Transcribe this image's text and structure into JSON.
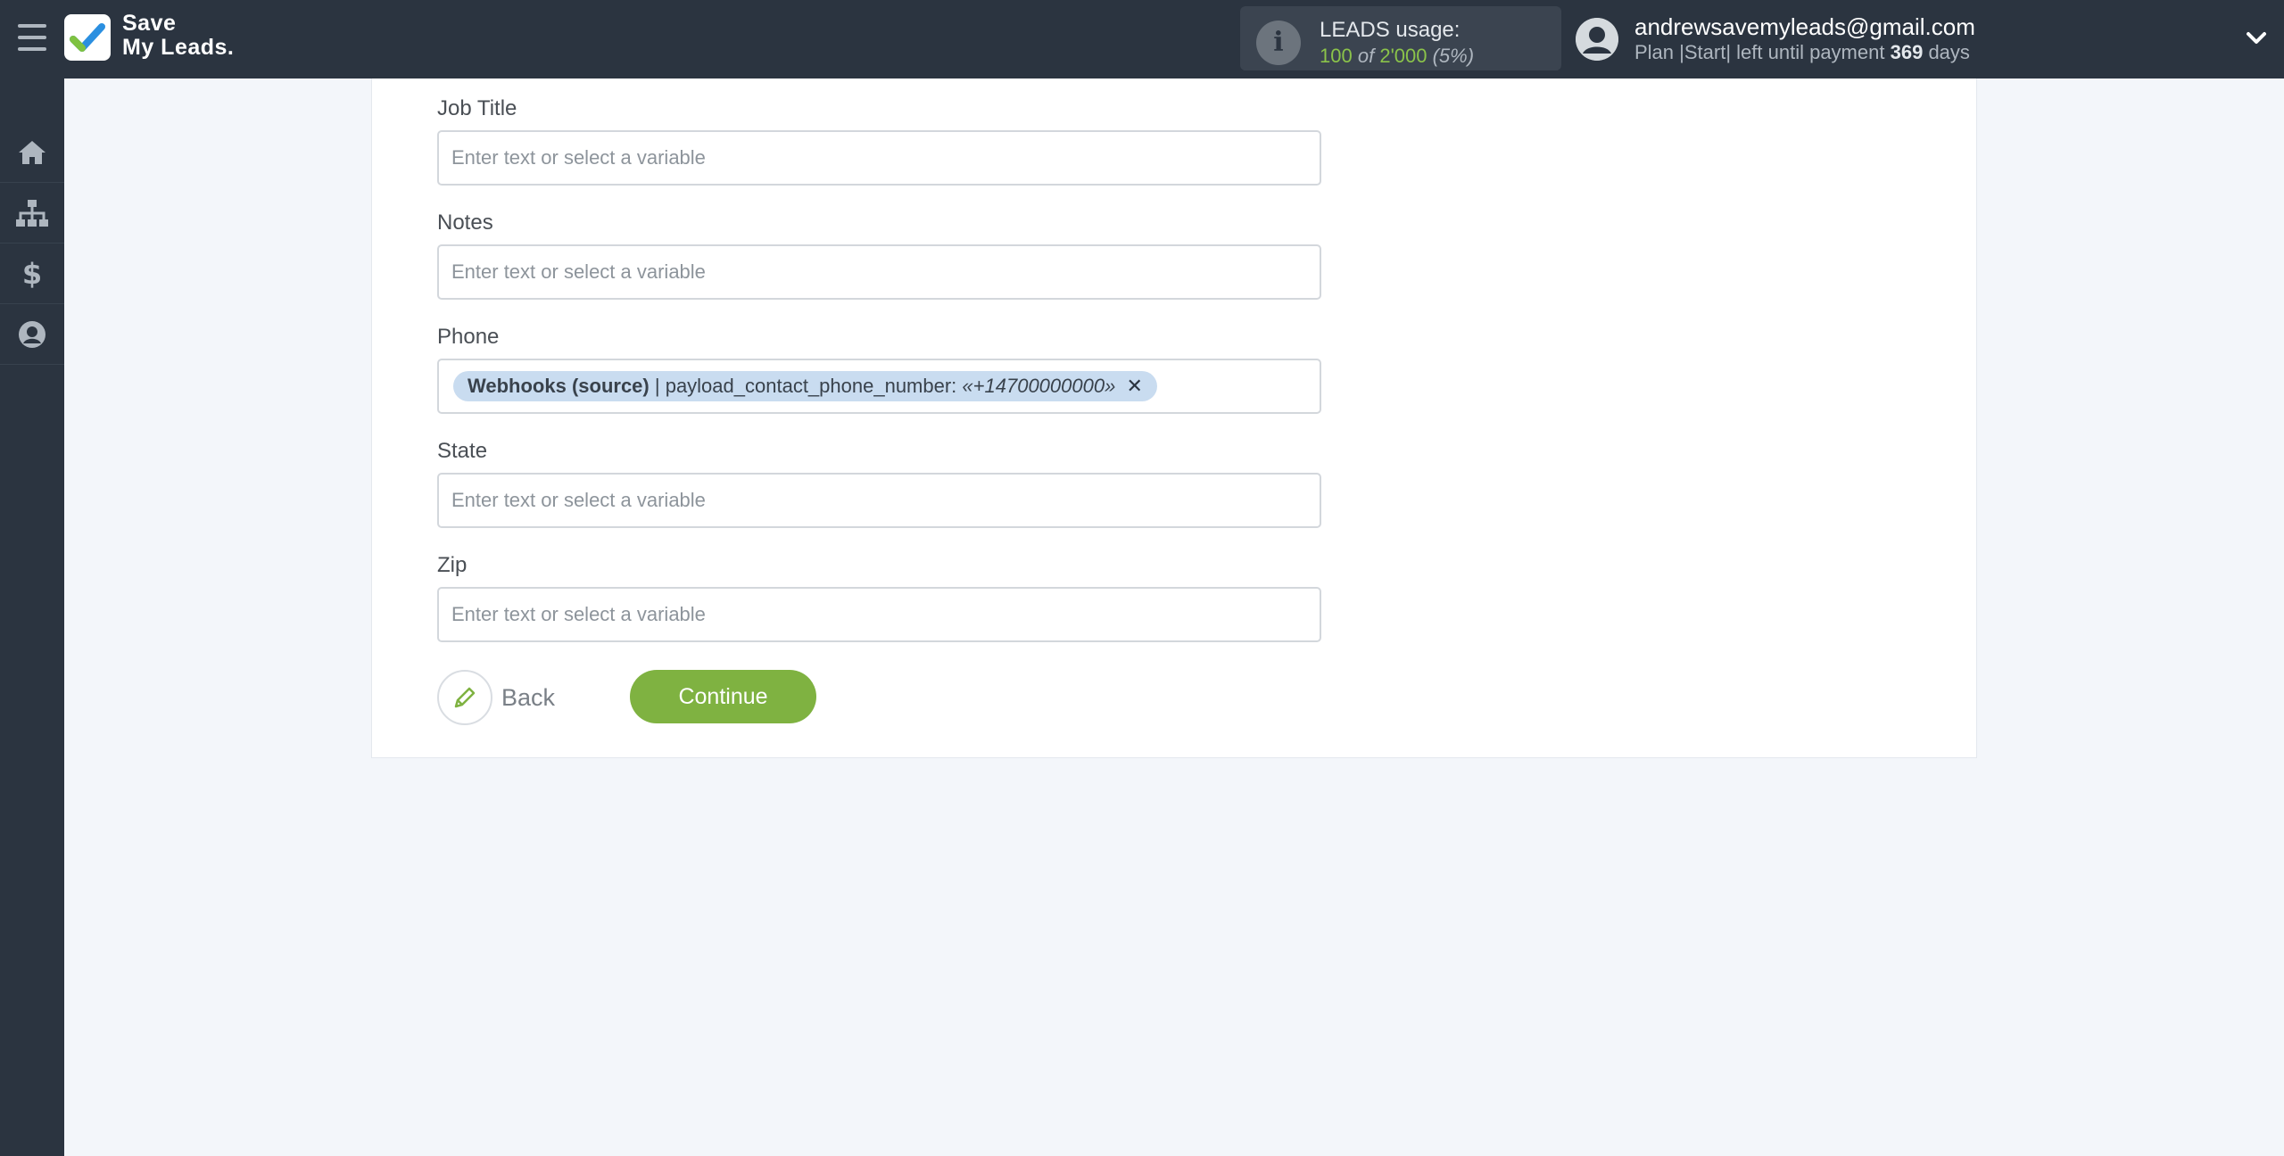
{
  "header": {
    "logo_line1": "Save",
    "logo_line2": "My Leads.",
    "usage_label": "LEADS usage:",
    "usage_used": "100",
    "usage_of": "of",
    "usage_total": "2'000",
    "usage_percent": "(5%)",
    "user_email": "andrewsavemyleads@gmail.com",
    "plan_prefix": "Plan |Start| left until payment",
    "plan_days": "369",
    "plan_suffix": "days"
  },
  "sidebar": {
    "items": [
      "home-icon",
      "sitemap-icon",
      "dollar-icon",
      "user-circle-icon"
    ]
  },
  "form": {
    "fields": [
      {
        "label": "Job Title",
        "placeholder": "Enter text or select a variable"
      },
      {
        "label": "Notes",
        "placeholder": "Enter text or select a variable"
      },
      {
        "label": "Phone",
        "tag_source": "Webhooks (source)",
        "tag_field": "| payload_contact_phone_number:",
        "tag_value": "«+14700000000»",
        "tag_remove": "✕"
      },
      {
        "label": "State",
        "placeholder": "Enter text or select a variable"
      },
      {
        "label": "Zip",
        "placeholder": "Enter text or select a variable"
      }
    ],
    "back_label": "Back",
    "continue_label": "Continue"
  },
  "colors": {
    "topbar": "#2b3440",
    "accent_green": "#7fb241",
    "tag_bg": "#c9dcf0",
    "page_bg": "#f3f6fa"
  }
}
